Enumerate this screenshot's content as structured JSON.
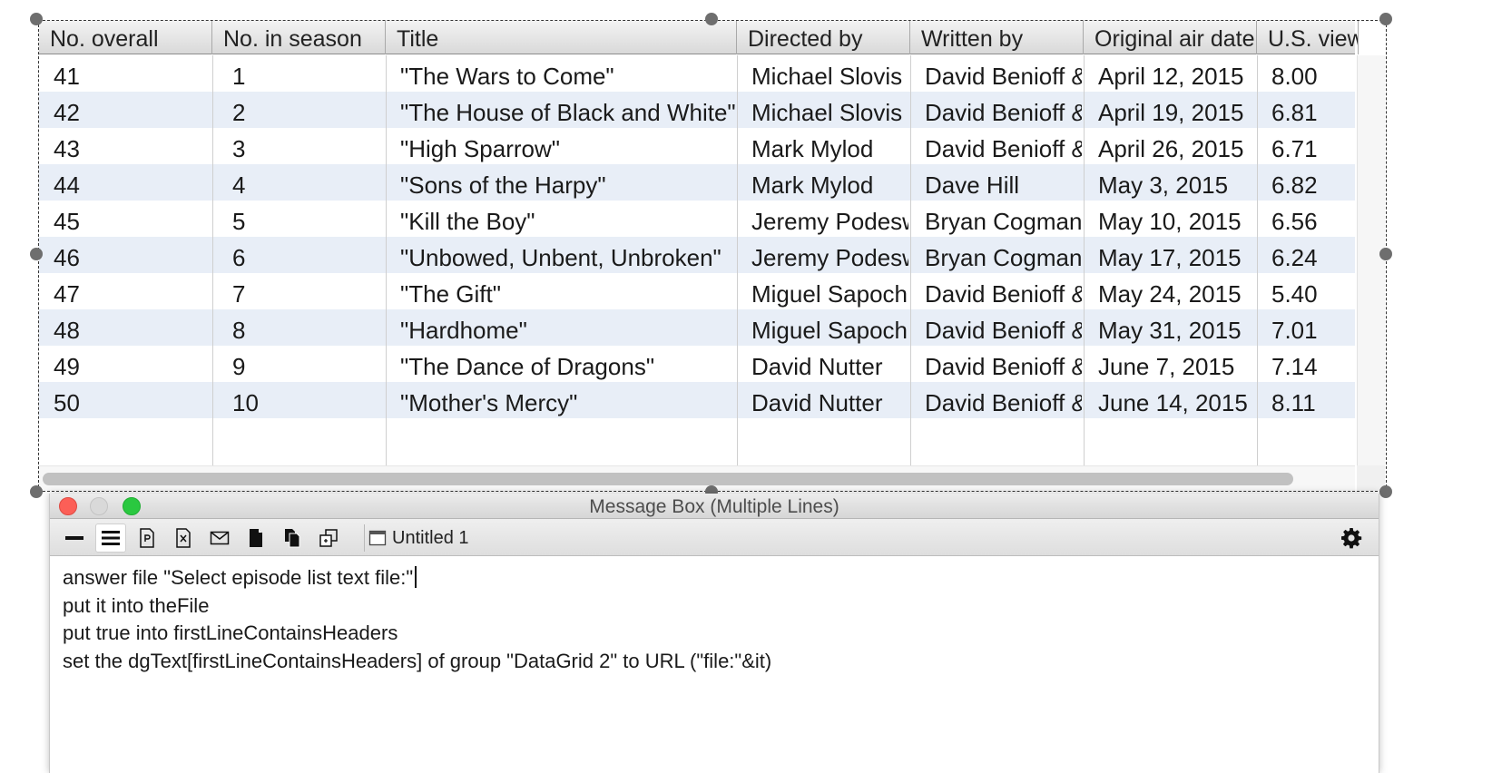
{
  "grid": {
    "columns": [
      {
        "key": "overall",
        "label": "No. overall"
      },
      {
        "key": "season",
        "label": "No. in season"
      },
      {
        "key": "title",
        "label": "Title"
      },
      {
        "key": "director",
        "label": "Directed by"
      },
      {
        "key": "writer",
        "label": "Written by"
      },
      {
        "key": "airdate",
        "label": "Original air date"
      },
      {
        "key": "viewers",
        "label": "U.S. viewers"
      }
    ],
    "rows": [
      {
        "overall": "41",
        "season": "1",
        "title": "\"The Wars to Come\"",
        "director": "Michael Slovis",
        "writer": "David Benioff &",
        "airdate": "April 12, 2015",
        "viewers": "8.00"
      },
      {
        "overall": "42",
        "season": "2",
        "title": "\"The House of Black and White\"",
        "director": "Michael Slovis",
        "writer": "David Benioff &",
        "airdate": "April 19, 2015",
        "viewers": "6.81"
      },
      {
        "overall": "43",
        "season": "3",
        "title": "\"High Sparrow\"",
        "director": "Mark Mylod",
        "writer": "David Benioff &",
        "airdate": "April 26, 2015",
        "viewers": "6.71"
      },
      {
        "overall": "44",
        "season": "4",
        "title": "\"Sons of the Harpy\"",
        "director": "Mark Mylod",
        "writer": "Dave Hill",
        "airdate": "May 3, 2015",
        "viewers": "6.82"
      },
      {
        "overall": "45",
        "season": "5",
        "title": "\"Kill the Boy\"",
        "director": "Jeremy Podeswa",
        "writer": "Bryan Cogman",
        "airdate": "May 10, 2015",
        "viewers": "6.56"
      },
      {
        "overall": "46",
        "season": "6",
        "title": "\"Unbowed, Unbent, Unbroken\"",
        "director": "Jeremy Podeswa",
        "writer": "Bryan Cogman",
        "airdate": "May 17, 2015",
        "viewers": "6.24"
      },
      {
        "overall": "47",
        "season": "7",
        "title": "\"The Gift\"",
        "director": "Miguel Sapochnik",
        "writer": "David Benioff &",
        "airdate": "May 24, 2015",
        "viewers": "5.40"
      },
      {
        "overall": "48",
        "season": "8",
        "title": "\"Hardhome\"",
        "director": "Miguel Sapochnik",
        "writer": "David Benioff &",
        "airdate": "May 31, 2015",
        "viewers": "7.01"
      },
      {
        "overall": "49",
        "season": "9",
        "title": "\"The Dance of Dragons\"",
        "director": "David Nutter",
        "writer": "David Benioff &",
        "airdate": "June 7, 2015",
        "viewers": "7.14"
      },
      {
        "overall": "50",
        "season": "10",
        "title": "\"Mother's Mercy\"",
        "director": "David Nutter",
        "writer": "David Benioff &",
        "airdate": "June 14, 2015",
        "viewers": "8.11"
      }
    ]
  },
  "message_box": {
    "title": "Message Box (Multiple Lines)",
    "tab_label": "Untitled 1",
    "toolbar_icons": [
      "single-line-icon",
      "multiple-lines-icon",
      "script-file-icon",
      "text-file-icon",
      "envelope-icon",
      "document-icon",
      "documents-icon",
      "copy-icon"
    ],
    "script_lines": [
      "answer file \"Select episode list text file:\"",
      "put it into theFile",
      "put true into firstLineContainsHeaders",
      "set the dgText[firstLineContainsHeaders] of group \"DataGrid 2\" to URL (\"file:\"&it)"
    ]
  },
  "colors": {
    "row_alt": "#e8eef7",
    "close": "#fc5f57",
    "maximize": "#2ac840"
  }
}
